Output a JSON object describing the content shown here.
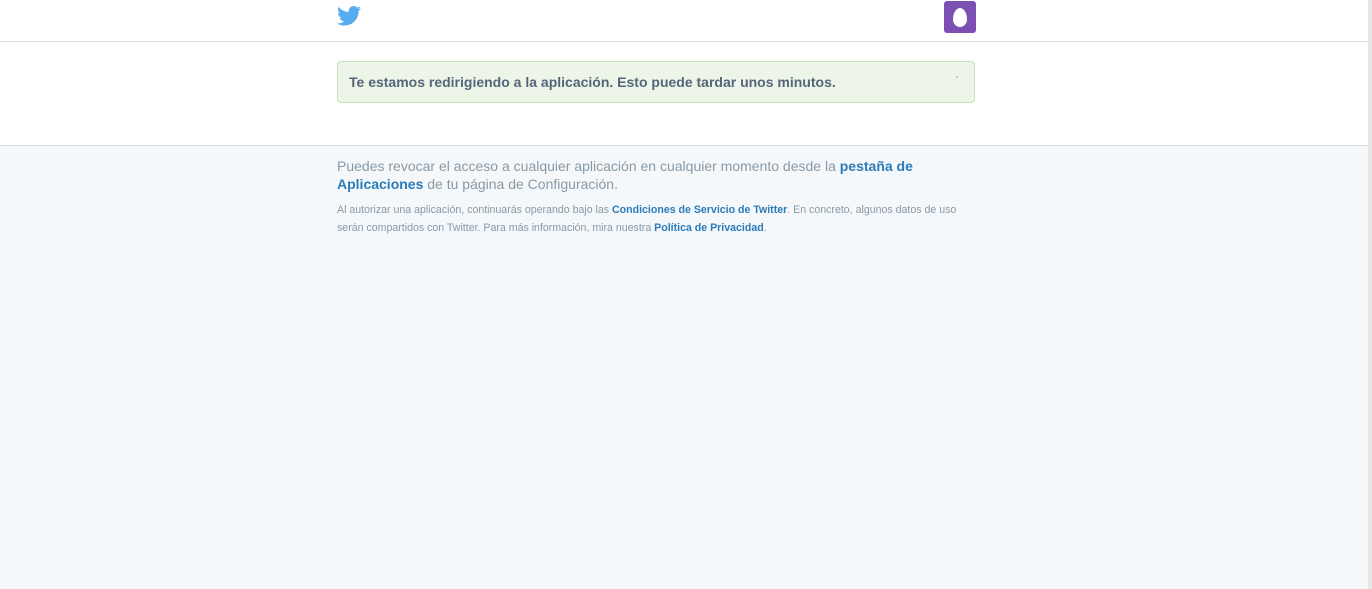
{
  "header": {
    "logo_icon": "twitter-bird-icon",
    "avatar_icon": "default-egg-avatar-icon",
    "brand_color": "#55acee",
    "avatar_color": "#7c4fb3"
  },
  "notice": {
    "message": "Te estamos redirigiendo a la aplicación. Esto puede tardar unos minutos."
  },
  "footer": {
    "revoke_text_1": "Puedes revocar el acceso a cualquier aplicación en cualquier momento desde la ",
    "revoke_link": "pestaña de Aplicaciones",
    "revoke_text_2": " de tu página de Configuración.",
    "terms_text_1": "Al autorizar una aplicación, continuarás operando bajo las ",
    "terms_link": "Condiciones de Servicio de Twitter",
    "terms_text_2": ". En concreto, algunos datos de uso serán compartidos con Twitter. Para más información, mira nuestra ",
    "privacy_link": "Política de Privacidad",
    "terms_text_3": "."
  }
}
